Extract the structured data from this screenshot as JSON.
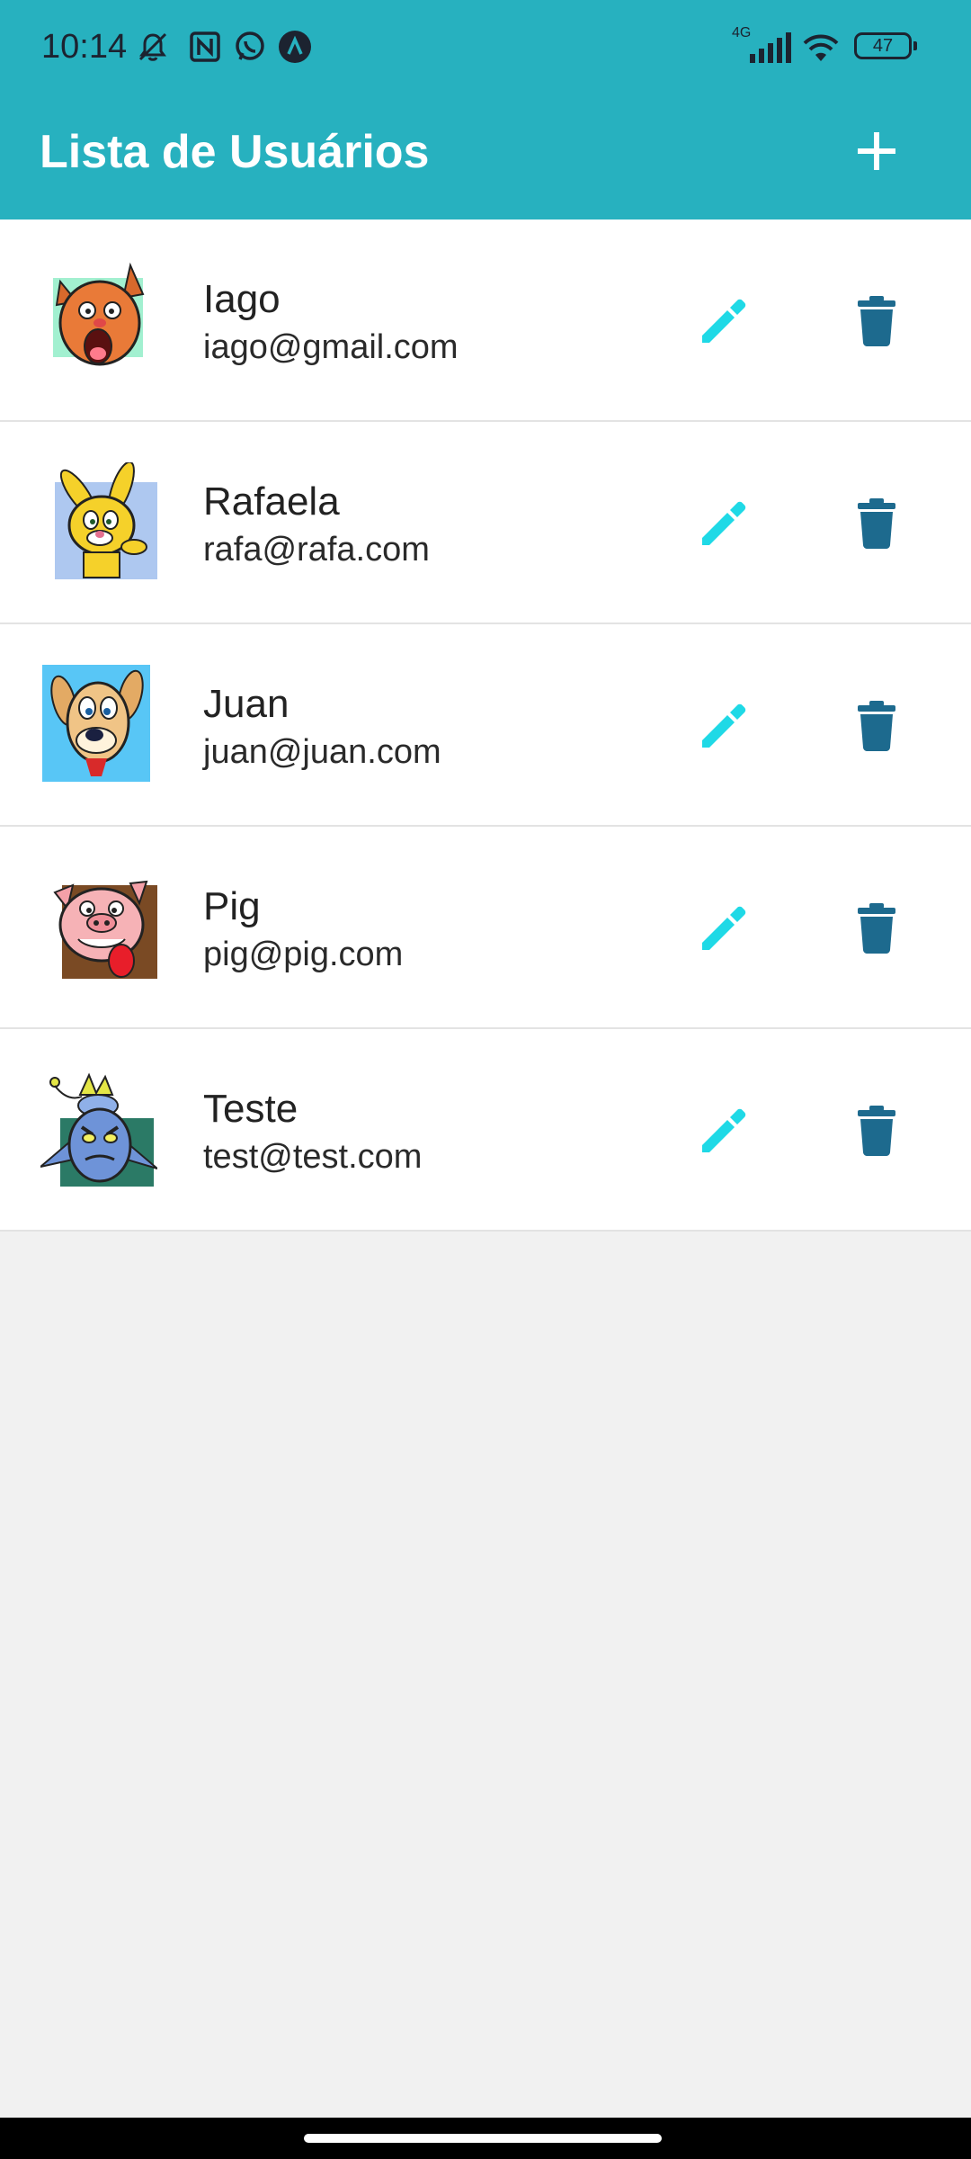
{
  "status_bar": {
    "time": "10:14",
    "network": "4G",
    "battery": "47",
    "icons": [
      "mute-vibrate-icon",
      "nfc-icon",
      "whatsapp-icon",
      "app-icon",
      "signal-icon",
      "wifi-icon",
      "battery-icon"
    ]
  },
  "app_bar": {
    "title": "Lista de Usuários",
    "add_icon": "plus-icon",
    "color": "#27b1bf"
  },
  "users": [
    {
      "name": "Iago",
      "email": "iago@gmail.com",
      "avatar": "cartoon-cat-avatar"
    },
    {
      "name": "Rafaela",
      "email": "rafa@rafa.com",
      "avatar": "cartoon-rabbit-avatar"
    },
    {
      "name": "Juan",
      "email": "juan@juan.com",
      "avatar": "cartoon-dog-avatar"
    },
    {
      "name": "Pig",
      "email": "pig@pig.com",
      "avatar": "cartoon-pig-avatar"
    },
    {
      "name": "Teste",
      "email": "test@test.com",
      "avatar": "cartoon-goblin-avatar"
    }
  ],
  "actions": {
    "edit_icon": "pencil-icon",
    "delete_icon": "trash-icon",
    "edit_color": "#1fd9e6",
    "delete_color": "#1d6a8e"
  }
}
